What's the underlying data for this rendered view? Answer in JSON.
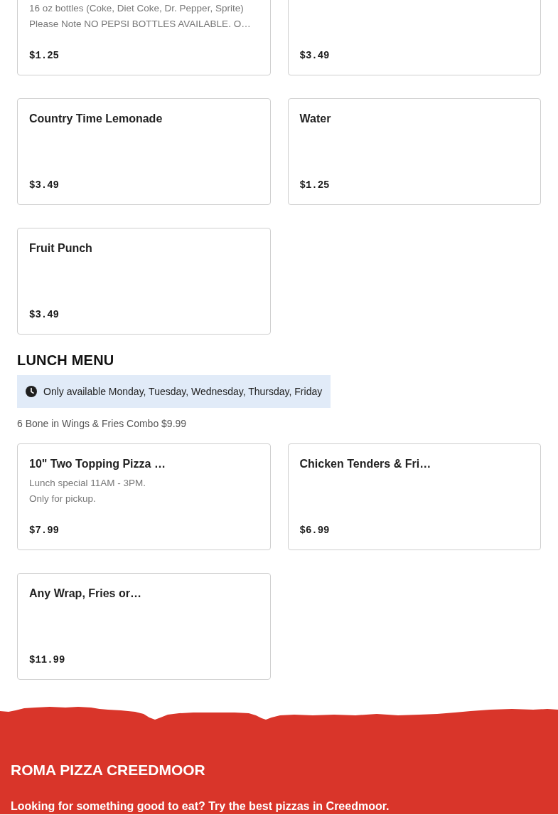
{
  "sections": [
    {
      "items": [
        {
          "description": [
            "16 oz bottles (Coke, Diet Coke, Dr. Pepper, Sprite)",
            "Please Note NO PEPSI BOTTLES AVAILABLE. O…"
          ],
          "price": "$1.25"
        },
        {
          "price": "$3.49"
        },
        {
          "name": "Country Time Lemonade",
          "price": "$3.49"
        },
        {
          "name": "Water",
          "price": "$1.25"
        },
        {
          "name": "Fruit Punch",
          "price": "$3.49"
        }
      ]
    },
    {
      "title": "LUNCH MENU",
      "availability": "Only available Monday, Tuesday, Wednesday, Thursday, Friday",
      "description": "6 Bone in Wings & Fries Combo $9.99",
      "items": [
        {
          "name": "10\" Two Topping Pizza …",
          "description": [
            "Lunch special 11AM - 3PM.",
            "Only for pickup."
          ],
          "price": "$7.99"
        },
        {
          "name": "Chicken Tenders & Fri…",
          "price": "$6.99"
        },
        {
          "name": "Any Wrap, Fries or…",
          "price": "$11.99"
        }
      ]
    }
  ],
  "footer": {
    "title": "ROMA PIZZA CREEDMOOR",
    "tagline": "Looking for something good to eat? Try the best pizzas in Creedmoor."
  }
}
